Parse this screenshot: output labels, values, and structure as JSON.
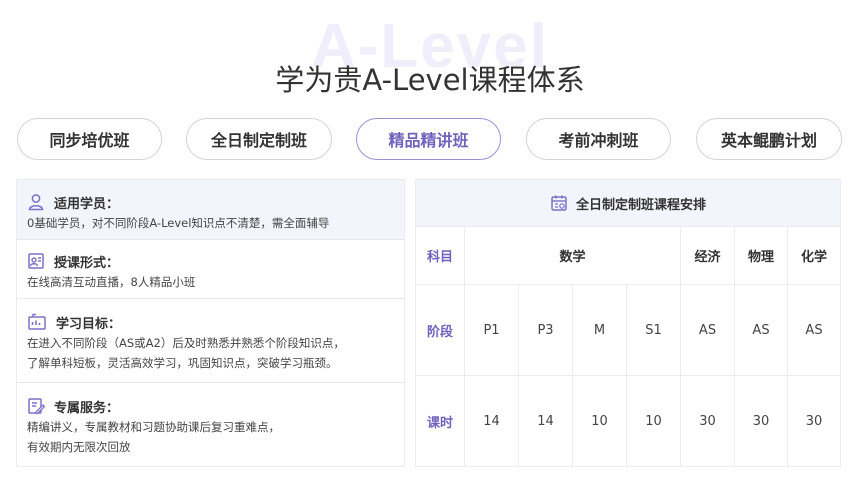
{
  "watermark": "A-Level",
  "title": "学为贵A-Level课程体系",
  "tabs": [
    {
      "label": "同步培优班",
      "active": false
    },
    {
      "label": "全日制定制班",
      "active": false
    },
    {
      "label": "精品精讲班",
      "active": true
    },
    {
      "label": "考前冲刺班",
      "active": false
    },
    {
      "label": "英本鲲鹏计划",
      "active": false
    }
  ],
  "accent_color": "#6f63bd",
  "info": [
    {
      "icon": "person-icon",
      "title": "适用学员：",
      "lines": [
        "0基础学员，对不同阶段A-Level知识点不清楚，需全面辅导"
      ]
    },
    {
      "icon": "teach-icon",
      "title": "授课形式：",
      "lines": [
        "在线高清互动直播，8人精品小班"
      ]
    },
    {
      "icon": "target-icon",
      "title": "学习目标：",
      "lines": [
        "在进入不同阶段（AS或A2）后及时熟悉并熟悉个阶段知识点，",
        "了解单科短板，灵活高效学习，巩固知识点，突破学习瓶颈。"
      ]
    },
    {
      "icon": "service-icon",
      "title": "专属服务：",
      "lines": [
        "精编讲义，专属教材和习题协助课后复习重难点，",
        "有效期内无限次回放"
      ]
    }
  ],
  "schedule": {
    "title": "全日制定制班课程安排",
    "row_labels": {
      "subject": "科目",
      "stage": "阶段",
      "hours": "课时"
    },
    "subjects": [
      "数学",
      "经济",
      "物理",
      "化学"
    ],
    "stages": [
      "P1",
      "P3",
      "M",
      "S1",
      "AS",
      "AS",
      "AS"
    ],
    "hours": [
      "14",
      "14",
      "10",
      "10",
      "30",
      "30",
      "30"
    ]
  }
}
